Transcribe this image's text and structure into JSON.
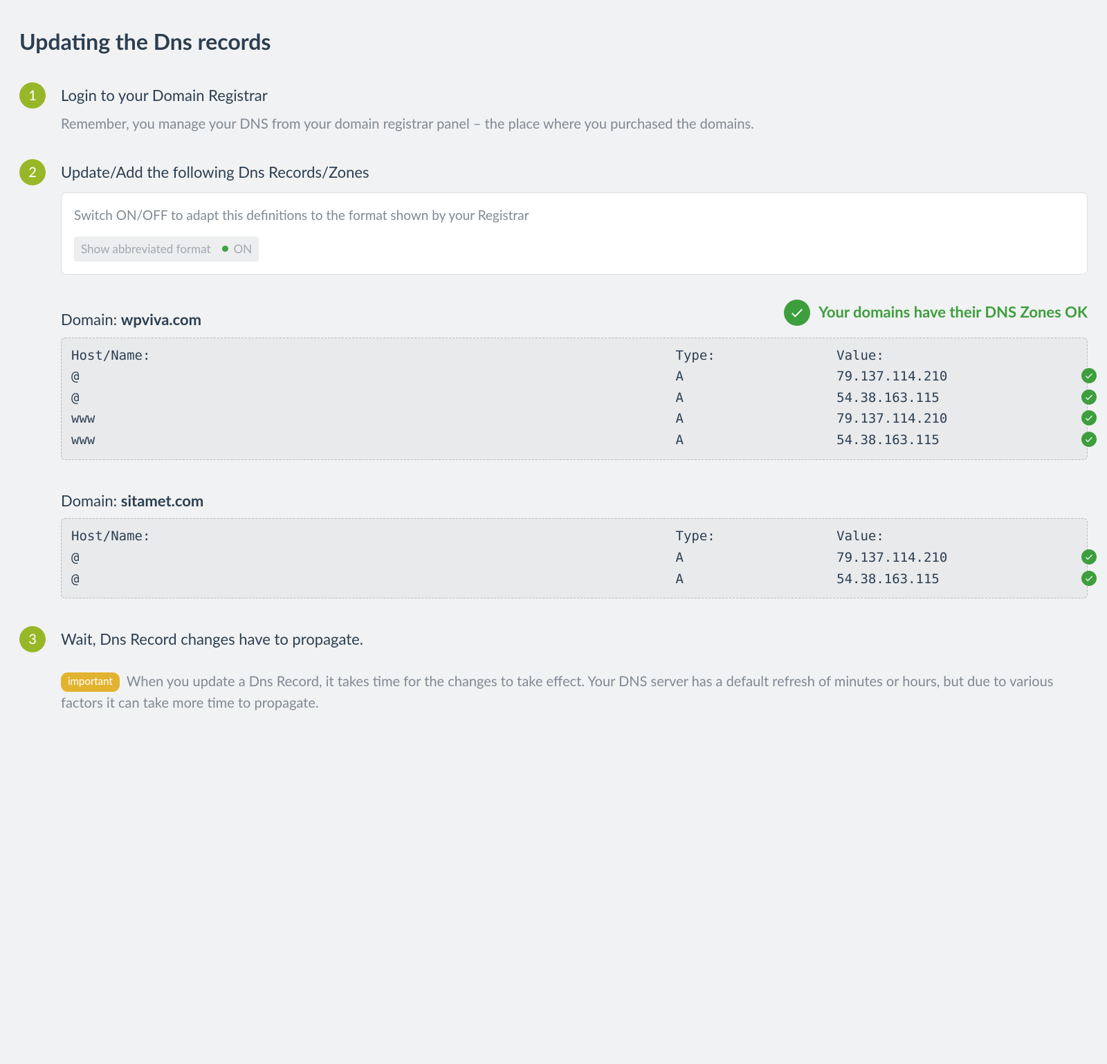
{
  "page": {
    "title": "Updating the Dns records"
  },
  "steps": [
    {
      "num": "1",
      "title": "Login to your Domain Registrar",
      "body": "Remember, you manage your DNS from your domain registrar panel – the place where you purchased the domains."
    },
    {
      "num": "2",
      "title": "Update/Add the following Dns Records/Zones",
      "panel": {
        "desc": "Switch ON/OFF to adapt this definitions to the format shown by your Registrar",
        "toggle_label": "Show abbreviated format",
        "toggle_state": "ON"
      },
      "status": "Your domains have their DNS Zones OK",
      "domain_label_prefix": "Domain: ",
      "headers": {
        "host": "Host/Name:",
        "type": "Type:",
        "value": "Value:"
      },
      "domains": [
        {
          "name": "wpviva.com",
          "records": [
            {
              "host": "@",
              "type": "A",
              "value": "79.137.114.210",
              "ok": true
            },
            {
              "host": "@",
              "type": "A",
              "value": "54.38.163.115",
              "ok": true
            },
            {
              "host": "www",
              "type": "A",
              "value": "79.137.114.210",
              "ok": true
            },
            {
              "host": "www",
              "type": "A",
              "value": "54.38.163.115",
              "ok": true
            }
          ]
        },
        {
          "name": "sitamet.com",
          "records": [
            {
              "host": "@",
              "type": "A",
              "value": "79.137.114.210",
              "ok": true
            },
            {
              "host": "@",
              "type": "A",
              "value": "54.38.163.115",
              "ok": true
            }
          ]
        }
      ]
    },
    {
      "num": "3",
      "title": "Wait, Dns Record changes have to propagate.",
      "badge": "important",
      "body": "When you update a Dns Record, it takes time for the changes to take effect. Your DNS server has a default refresh of minutes or hours, but due to various factors it can take more time to propagate."
    }
  ]
}
